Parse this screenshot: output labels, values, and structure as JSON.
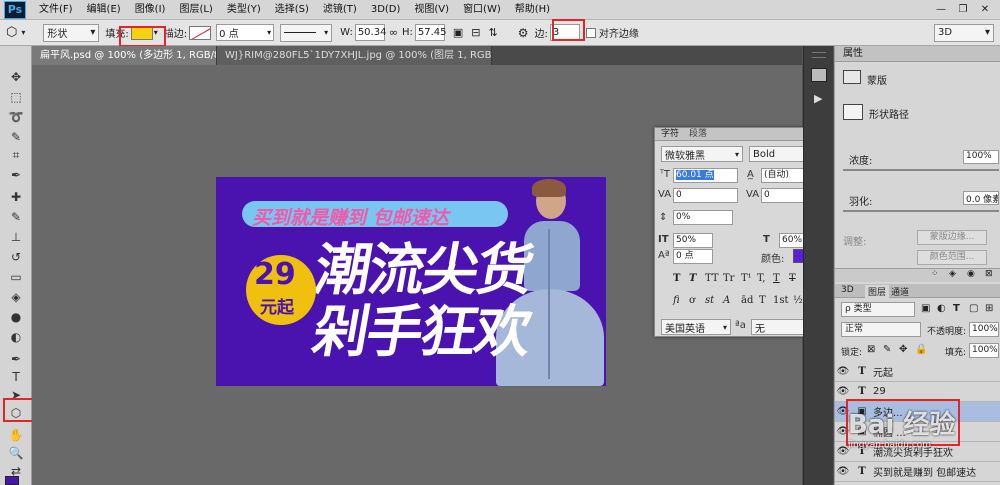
{
  "app": {
    "logo": "Ps"
  },
  "menu": [
    "文件(F)",
    "编辑(E)",
    "图像(I)",
    "图层(L)",
    "类型(Y)",
    "选择(S)",
    "滤镜(T)",
    "3D(D)",
    "视图(V)",
    "窗口(W)",
    "帮助(H)"
  ],
  "window_controls": {
    "minimize": "—",
    "restore": "❐",
    "close": "✕"
  },
  "options": {
    "shape_mode": "形状",
    "fill_label": "填充:",
    "stroke_label": "描边:",
    "stroke_width": "0 点",
    "w_label": "W:",
    "w_value": "50.34",
    "h_label": "H:",
    "h_value": "57.45",
    "sides_label": "边:",
    "sides_value": "3",
    "align_edges": "对齐边缘",
    "workspace": "3D",
    "fill_color": "#f5d40f"
  },
  "tabs": [
    {
      "label": "扁平风.psd @ 100% (多边形 1, RGB/8) *",
      "close": "×"
    },
    {
      "label": "WJ}RIM@280FL5`1DY7XHJL.jpg @ 100% (图层 1, RGB/8#) *",
      "close": "×"
    }
  ],
  "banner": {
    "top_line": "买到就是赚到 包邮速达",
    "title1": "潮流尖货",
    "title2": "剁手狂欢",
    "price": "29",
    "price_suffix": "元起",
    "bg_color": "#4a13b0",
    "badge_color": "#f0c00e"
  },
  "char_panel": {
    "tab_char": "字符",
    "tab_para": "段落",
    "font": "微软雅黑",
    "style": "Bold",
    "size": "60.01 点",
    "leading": "(自动)",
    "kerning": "0",
    "tracking": "0",
    "scale_pct": "0%",
    "vscale": "50%",
    "hscale": "60%",
    "baseline": "0 点",
    "color_label": "颜色:",
    "color_value": "#5a1ee0",
    "glyphs1": [
      "T",
      "T",
      "TT",
      "Tr",
      "T¹",
      "T,",
      "T",
      "T"
    ],
    "glyphs2": [
      "fi",
      "ơ",
      "st",
      "A",
      "ād",
      "T",
      "1st",
      "½"
    ],
    "language": "美国英语",
    "aa_label": "ªa",
    "aa_value": "无"
  },
  "properties": {
    "title": "属性",
    "mask": "蒙版",
    "shape_path": "形状路径",
    "density_label": "浓度:",
    "density_value": "100%",
    "feather_label": "羽化:",
    "feather_value": "0.0 像素",
    "adjust_label": "调整:",
    "mask_edge": "蒙版边缘...",
    "color_range": "颜色范围..."
  },
  "layers": {
    "tab_3d": "3D",
    "tab_layers": "图层",
    "tab_channels": "通道",
    "kind": "ρ 类型",
    "blend": "正常",
    "opacity_label": "不透明度:",
    "opacity_value": "100%",
    "lock_label": "锁定:",
    "fill_label": "填充:",
    "fill_value": "100%",
    "items": [
      {
        "name": "元起",
        "type": "T"
      },
      {
        "name": "29",
        "type": "T"
      },
      {
        "name": "多边...",
        "type": "shape"
      },
      {
        "name": "椭圆 ...",
        "type": "shape"
      },
      {
        "name": "潮流尖货剁手狂欢",
        "type": "T"
      },
      {
        "name": "买到就是赚到 包邮速达",
        "type": "T"
      }
    ]
  },
  "watermark": {
    "text": "Bai 经验",
    "sub": "jingyan.baidu.com"
  }
}
